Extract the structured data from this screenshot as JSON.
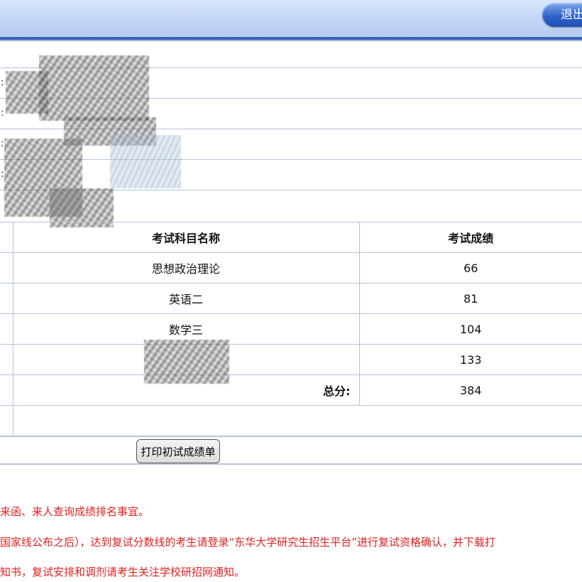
{
  "header": {
    "logout_label": "退出"
  },
  "info": {
    "colon": ":"
  },
  "table": {
    "headers": [
      "考试科目名称",
      "考试成绩"
    ],
    "rows": [
      {
        "subject": "思想政治理论",
        "score": "66"
      },
      {
        "subject": "英语二",
        "score": "81"
      },
      {
        "subject": "数学三",
        "score": "104"
      },
      {
        "subject": "",
        "score": "133"
      }
    ],
    "total_label": "总分:",
    "total_score": "384"
  },
  "print_button_label": "打印初试成绩单",
  "notices": [
    "来函、来人查询成绩排名事宜。",
    "国家线公布之后），达到复试分数线的考生请登录“东华大学研究生招生平台”进行复试资格确认，并下载打",
    "知书，复试安排和调剂请考生关注学校研招网通知。"
  ],
  "colors": {
    "header_blue": "#3d64b4",
    "notice_red": "#e02020",
    "grid_line": "#b4c4dc"
  }
}
